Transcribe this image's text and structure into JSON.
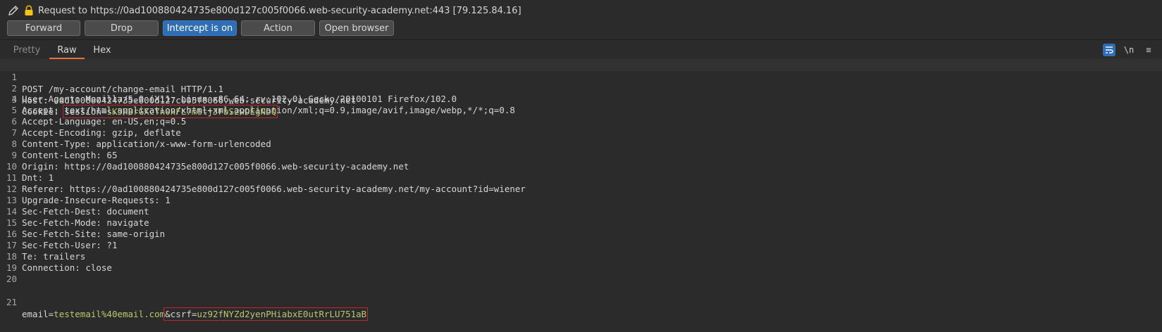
{
  "header": {
    "request_title": "Request to https://0ad100880424735e800d127c005f0066.web-security-academy.net:443  [79.125.84.16]",
    "icons": {
      "edit": "pencil-icon",
      "lock": "lock-icon"
    }
  },
  "toolbar": {
    "forward": "Forward",
    "drop": "Drop",
    "intercept": "Intercept is on",
    "action": "Action",
    "open_browser": "Open browser"
  },
  "tabs": {
    "pretty": "Pretty",
    "raw": "Raw",
    "hex": "Hex"
  },
  "tools": {
    "newline": "\\n",
    "menu": "≡",
    "wrap_icon": "wrap-text-icon"
  },
  "colors": {
    "accent": "#2f6db5",
    "tab_underline": "#e8743b",
    "highlight_box": "#c0272d",
    "param_value": "#b8c86a"
  },
  "request": {
    "request_line": "POST /my-account/change-email HTTP/1.1",
    "headers": [
      {
        "name": "Host:",
        "value": " 0ad100880424735e800d127c005f0066.web-security-academy.net"
      },
      {
        "name": "Cookie:",
        "value": ""
      },
      {
        "name": "User-Agent:",
        "value": " Mozilla/5.0 (X11; Linux x86_64; rv:102.0) Gecko/20100101 Firefox/102.0"
      },
      {
        "name": "Accept:",
        "value": " text/html,application/xhtml+xml,application/xml;q=0.9,image/avif,image/webp,*/*;q=0.8"
      },
      {
        "name": "Accept-Language:",
        "value": " en-US,en;q=0.5"
      },
      {
        "name": "Accept-Encoding:",
        "value": " gzip, deflate"
      },
      {
        "name": "Content-Type:",
        "value": " application/x-www-form-urlencoded"
      },
      {
        "name": "Content-Length:",
        "value": " 65"
      },
      {
        "name": "Origin:",
        "value": " https://0ad100880424735e800d127c005f0066.web-security-academy.net"
      },
      {
        "name": "Dnt:",
        "value": " 1"
      },
      {
        "name": "Referer:",
        "value": " https://0ad100880424735e800d127c005f0066.web-security-academy.net/my-account?id=wiener"
      },
      {
        "name": "Upgrade-Insecure-Requests:",
        "value": " 1"
      },
      {
        "name": "Sec-Fetch-Dest:",
        "value": " document"
      },
      {
        "name": "Sec-Fetch-Mode:",
        "value": " navigate"
      },
      {
        "name": "Sec-Fetch-Site:",
        "value": " same-origin"
      },
      {
        "name": "Sec-Fetch-User:",
        "value": " ?1"
      },
      {
        "name": "Te:",
        "value": " trailers"
      },
      {
        "name": "Connection:",
        "value": " close"
      }
    ],
    "cookie": {
      "name": "session",
      "value": "sK5HBrGXcYn0xFL7m6tjJFbS2wDEgNDQ"
    },
    "body": {
      "email_name": "email",
      "email_value": "testemail%40email.com",
      "amp": "&",
      "csrf_name": "csrf",
      "csrf_value": "uz92fNYZd2yenPHiabxE0utRrLU751aB"
    },
    "line_numbers": [
      "1",
      "2",
      "3",
      "4",
      "5",
      "6",
      "7",
      "8",
      "9",
      "10",
      "11",
      "12",
      "13",
      "14",
      "15",
      "16",
      "17",
      "18",
      "19",
      "20",
      "21"
    ]
  }
}
